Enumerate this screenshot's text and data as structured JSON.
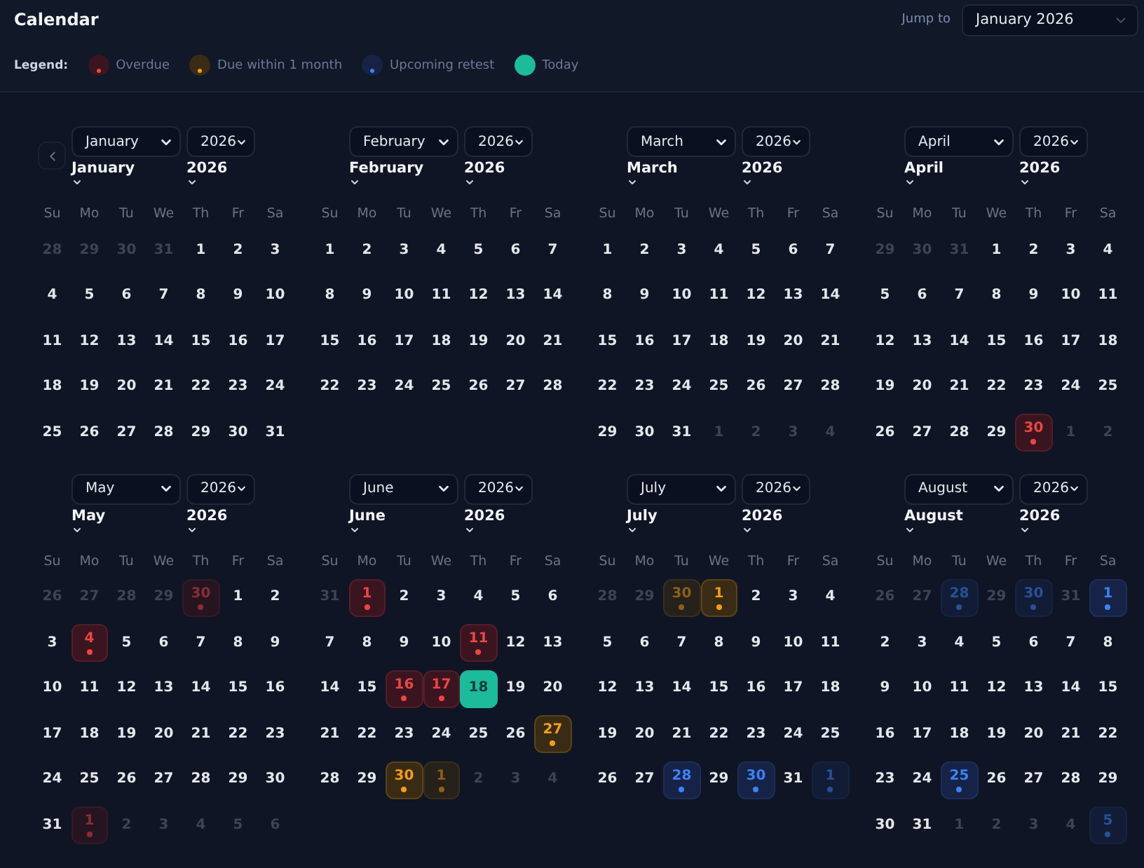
{
  "title": "Calendar",
  "jump": {
    "label": "Jump to",
    "value": "January 2026"
  },
  "legend": {
    "label": "Legend:",
    "items": [
      {
        "label": "Overdue",
        "kind": "overdue"
      },
      {
        "label": "Due within 1 month",
        "kind": "due"
      },
      {
        "label": "Upcoming retest",
        "kind": "retest"
      },
      {
        "label": "Today",
        "kind": "today"
      }
    ]
  },
  "months": [
    {
      "month": "January",
      "year": "2026",
      "caption_month": "January",
      "caption_year": "2026",
      "weekdays": [
        "Su",
        "Mo",
        "Tu",
        "We",
        "Th",
        "Fr",
        "Sa"
      ],
      "weeks": [
        [
          {
            "day": "28",
            "outside": true,
            "kind": "plain"
          },
          {
            "day": "29",
            "outside": true,
            "kind": "plain"
          },
          {
            "day": "30",
            "outside": true,
            "kind": "plain"
          },
          {
            "day": "31",
            "outside": true,
            "kind": "plain"
          },
          {
            "day": "1",
            "outside": false,
            "kind": "plain"
          },
          {
            "day": "2",
            "outside": false,
            "kind": "plain"
          },
          {
            "day": "3",
            "outside": false,
            "kind": "plain"
          }
        ],
        [
          {
            "day": "4",
            "outside": false,
            "kind": "plain"
          },
          {
            "day": "5",
            "outside": false,
            "kind": "plain"
          },
          {
            "day": "6",
            "outside": false,
            "kind": "plain"
          },
          {
            "day": "7",
            "outside": false,
            "kind": "plain"
          },
          {
            "day": "8",
            "outside": false,
            "kind": "plain"
          },
          {
            "day": "9",
            "outside": false,
            "kind": "plain"
          },
          {
            "day": "10",
            "outside": false,
            "kind": "plain"
          }
        ],
        [
          {
            "day": "11",
            "outside": false,
            "kind": "plain"
          },
          {
            "day": "12",
            "outside": false,
            "kind": "plain"
          },
          {
            "day": "13",
            "outside": false,
            "kind": "plain"
          },
          {
            "day": "14",
            "outside": false,
            "kind": "plain"
          },
          {
            "day": "15",
            "outside": false,
            "kind": "plain"
          },
          {
            "day": "16",
            "outside": false,
            "kind": "plain"
          },
          {
            "day": "17",
            "outside": false,
            "kind": "plain"
          }
        ],
        [
          {
            "day": "18",
            "outside": false,
            "kind": "plain"
          },
          {
            "day": "19",
            "outside": false,
            "kind": "plain"
          },
          {
            "day": "20",
            "outside": false,
            "kind": "plain"
          },
          {
            "day": "21",
            "outside": false,
            "kind": "plain"
          },
          {
            "day": "22",
            "outside": false,
            "kind": "plain"
          },
          {
            "day": "23",
            "outside": false,
            "kind": "plain"
          },
          {
            "day": "24",
            "outside": false,
            "kind": "plain"
          }
        ],
        [
          {
            "day": "25",
            "outside": false,
            "kind": "plain"
          },
          {
            "day": "26",
            "outside": false,
            "kind": "plain"
          },
          {
            "day": "27",
            "outside": false,
            "kind": "plain"
          },
          {
            "day": "28",
            "outside": false,
            "kind": "plain"
          },
          {
            "day": "29",
            "outside": false,
            "kind": "plain"
          },
          {
            "day": "30",
            "outside": false,
            "kind": "plain"
          },
          {
            "day": "31",
            "outside": false,
            "kind": "plain"
          }
        ]
      ]
    },
    {
      "month": "February",
      "year": "2026",
      "caption_month": "February",
      "caption_year": "2026",
      "weekdays": [
        "Su",
        "Mo",
        "Tu",
        "We",
        "Th",
        "Fr",
        "Sa"
      ],
      "weeks": [
        [
          {
            "day": "1",
            "outside": false,
            "kind": "plain"
          },
          {
            "day": "2",
            "outside": false,
            "kind": "plain"
          },
          {
            "day": "3",
            "outside": false,
            "kind": "plain"
          },
          {
            "day": "4",
            "outside": false,
            "kind": "plain"
          },
          {
            "day": "5",
            "outside": false,
            "kind": "plain"
          },
          {
            "day": "6",
            "outside": false,
            "kind": "plain"
          },
          {
            "day": "7",
            "outside": false,
            "kind": "plain"
          }
        ],
        [
          {
            "day": "8",
            "outside": false,
            "kind": "plain"
          },
          {
            "day": "9",
            "outside": false,
            "kind": "plain"
          },
          {
            "day": "10",
            "outside": false,
            "kind": "plain"
          },
          {
            "day": "11",
            "outside": false,
            "kind": "plain"
          },
          {
            "day": "12",
            "outside": false,
            "kind": "plain"
          },
          {
            "day": "13",
            "outside": false,
            "kind": "plain"
          },
          {
            "day": "14",
            "outside": false,
            "kind": "plain"
          }
        ],
        [
          {
            "day": "15",
            "outside": false,
            "kind": "plain"
          },
          {
            "day": "16",
            "outside": false,
            "kind": "plain"
          },
          {
            "day": "17",
            "outside": false,
            "kind": "plain"
          },
          {
            "day": "18",
            "outside": false,
            "kind": "plain"
          },
          {
            "day": "19",
            "outside": false,
            "kind": "plain"
          },
          {
            "day": "20",
            "outside": false,
            "kind": "plain"
          },
          {
            "day": "21",
            "outside": false,
            "kind": "plain"
          }
        ],
        [
          {
            "day": "22",
            "outside": false,
            "kind": "plain"
          },
          {
            "day": "23",
            "outside": false,
            "kind": "plain"
          },
          {
            "day": "24",
            "outside": false,
            "kind": "plain"
          },
          {
            "day": "25",
            "outside": false,
            "kind": "plain"
          },
          {
            "day": "26",
            "outside": false,
            "kind": "plain"
          },
          {
            "day": "27",
            "outside": false,
            "kind": "plain"
          },
          {
            "day": "28",
            "outside": false,
            "kind": "plain"
          }
        ]
      ]
    },
    {
      "month": "March",
      "year": "2026",
      "caption_month": "March",
      "caption_year": "2026",
      "weekdays": [
        "Su",
        "Mo",
        "Tu",
        "We",
        "Th",
        "Fr",
        "Sa"
      ],
      "weeks": [
        [
          {
            "day": "1",
            "outside": false,
            "kind": "plain"
          },
          {
            "day": "2",
            "outside": false,
            "kind": "plain"
          },
          {
            "day": "3",
            "outside": false,
            "kind": "plain"
          },
          {
            "day": "4",
            "outside": false,
            "kind": "plain"
          },
          {
            "day": "5",
            "outside": false,
            "kind": "plain"
          },
          {
            "day": "6",
            "outside": false,
            "kind": "plain"
          },
          {
            "day": "7",
            "outside": false,
            "kind": "plain"
          }
        ],
        [
          {
            "day": "8",
            "outside": false,
            "kind": "plain"
          },
          {
            "day": "9",
            "outside": false,
            "kind": "plain"
          },
          {
            "day": "10",
            "outside": false,
            "kind": "plain"
          },
          {
            "day": "11",
            "outside": false,
            "kind": "plain"
          },
          {
            "day": "12",
            "outside": false,
            "kind": "plain"
          },
          {
            "day": "13",
            "outside": false,
            "kind": "plain"
          },
          {
            "day": "14",
            "outside": false,
            "kind": "plain"
          }
        ],
        [
          {
            "day": "15",
            "outside": false,
            "kind": "plain"
          },
          {
            "day": "16",
            "outside": false,
            "kind": "plain"
          },
          {
            "day": "17",
            "outside": false,
            "kind": "plain"
          },
          {
            "day": "18",
            "outside": false,
            "kind": "plain"
          },
          {
            "day": "19",
            "outside": false,
            "kind": "plain"
          },
          {
            "day": "20",
            "outside": false,
            "kind": "plain"
          },
          {
            "day": "21",
            "outside": false,
            "kind": "plain"
          }
        ],
        [
          {
            "day": "22",
            "outside": false,
            "kind": "plain"
          },
          {
            "day": "23",
            "outside": false,
            "kind": "plain"
          },
          {
            "day": "24",
            "outside": false,
            "kind": "plain"
          },
          {
            "day": "25",
            "outside": false,
            "kind": "plain"
          },
          {
            "day": "26",
            "outside": false,
            "kind": "plain"
          },
          {
            "day": "27",
            "outside": false,
            "kind": "plain"
          },
          {
            "day": "28",
            "outside": false,
            "kind": "plain"
          }
        ],
        [
          {
            "day": "29",
            "outside": false,
            "kind": "plain"
          },
          {
            "day": "30",
            "outside": false,
            "kind": "plain"
          },
          {
            "day": "31",
            "outside": false,
            "kind": "plain"
          },
          {
            "day": "1",
            "outside": true,
            "kind": "plain"
          },
          {
            "day": "2",
            "outside": true,
            "kind": "plain"
          },
          {
            "day": "3",
            "outside": true,
            "kind": "plain"
          },
          {
            "day": "4",
            "outside": true,
            "kind": "plain"
          }
        ]
      ]
    },
    {
      "month": "April",
      "year": "2026",
      "caption_month": "April",
      "caption_year": "2026",
      "weekdays": [
        "Su",
        "Mo",
        "Tu",
        "We",
        "Th",
        "Fr",
        "Sa"
      ],
      "weeks": [
        [
          {
            "day": "29",
            "outside": true,
            "kind": "plain"
          },
          {
            "day": "30",
            "outside": true,
            "kind": "plain"
          },
          {
            "day": "31",
            "outside": true,
            "kind": "plain"
          },
          {
            "day": "1",
            "outside": false,
            "kind": "plain"
          },
          {
            "day": "2",
            "outside": false,
            "kind": "plain"
          },
          {
            "day": "3",
            "outside": false,
            "kind": "plain"
          },
          {
            "day": "4",
            "outside": false,
            "kind": "plain"
          }
        ],
        [
          {
            "day": "5",
            "outside": false,
            "kind": "plain"
          },
          {
            "day": "6",
            "outside": false,
            "kind": "plain"
          },
          {
            "day": "7",
            "outside": false,
            "kind": "plain"
          },
          {
            "day": "8",
            "outside": false,
            "kind": "plain"
          },
          {
            "day": "9",
            "outside": false,
            "kind": "plain"
          },
          {
            "day": "10",
            "outside": false,
            "kind": "plain"
          },
          {
            "day": "11",
            "outside": false,
            "kind": "plain"
          }
        ],
        [
          {
            "day": "12",
            "outside": false,
            "kind": "plain"
          },
          {
            "day": "13",
            "outside": false,
            "kind": "plain"
          },
          {
            "day": "14",
            "outside": false,
            "kind": "plain"
          },
          {
            "day": "15",
            "outside": false,
            "kind": "plain"
          },
          {
            "day": "16",
            "outside": false,
            "kind": "plain"
          },
          {
            "day": "17",
            "outside": false,
            "kind": "plain"
          },
          {
            "day": "18",
            "outside": false,
            "kind": "plain"
          }
        ],
        [
          {
            "day": "19",
            "outside": false,
            "kind": "plain"
          },
          {
            "day": "20",
            "outside": false,
            "kind": "plain"
          },
          {
            "day": "21",
            "outside": false,
            "kind": "plain"
          },
          {
            "day": "22",
            "outside": false,
            "kind": "plain"
          },
          {
            "day": "23",
            "outside": false,
            "kind": "plain"
          },
          {
            "day": "24",
            "outside": false,
            "kind": "plain"
          },
          {
            "day": "25",
            "outside": false,
            "kind": "plain"
          }
        ],
        [
          {
            "day": "26",
            "outside": false,
            "kind": "plain"
          },
          {
            "day": "27",
            "outside": false,
            "kind": "plain"
          },
          {
            "day": "28",
            "outside": false,
            "kind": "plain"
          },
          {
            "day": "29",
            "outside": false,
            "kind": "plain"
          },
          {
            "day": "30",
            "outside": false,
            "kind": "overdue"
          },
          {
            "day": "1",
            "outside": true,
            "kind": "plain"
          },
          {
            "day": "2",
            "outside": true,
            "kind": "plain"
          }
        ]
      ]
    },
    {
      "month": "May",
      "year": "2026",
      "caption_month": "May",
      "caption_year": "2026",
      "weekdays": [
        "Su",
        "Mo",
        "Tu",
        "We",
        "Th",
        "Fr",
        "Sa"
      ],
      "weeks": [
        [
          {
            "day": "26",
            "outside": true,
            "kind": "plain"
          },
          {
            "day": "27",
            "outside": true,
            "kind": "plain"
          },
          {
            "day": "28",
            "outside": true,
            "kind": "plain"
          },
          {
            "day": "29",
            "outside": true,
            "kind": "plain"
          },
          {
            "day": "30",
            "outside": true,
            "kind": "overdue"
          },
          {
            "day": "1",
            "outside": false,
            "kind": "plain"
          },
          {
            "day": "2",
            "outside": false,
            "kind": "plain"
          }
        ],
        [
          {
            "day": "3",
            "outside": false,
            "kind": "plain"
          },
          {
            "day": "4",
            "outside": false,
            "kind": "overdue"
          },
          {
            "day": "5",
            "outside": false,
            "kind": "plain"
          },
          {
            "day": "6",
            "outside": false,
            "kind": "plain"
          },
          {
            "day": "7",
            "outside": false,
            "kind": "plain"
          },
          {
            "day": "8",
            "outside": false,
            "kind": "plain"
          },
          {
            "day": "9",
            "outside": false,
            "kind": "plain"
          }
        ],
        [
          {
            "day": "10",
            "outside": false,
            "kind": "plain"
          },
          {
            "day": "11",
            "outside": false,
            "kind": "plain"
          },
          {
            "day": "12",
            "outside": false,
            "kind": "plain"
          },
          {
            "day": "13",
            "outside": false,
            "kind": "plain"
          },
          {
            "day": "14",
            "outside": false,
            "kind": "plain"
          },
          {
            "day": "15",
            "outside": false,
            "kind": "plain"
          },
          {
            "day": "16",
            "outside": false,
            "kind": "plain"
          }
        ],
        [
          {
            "day": "17",
            "outside": false,
            "kind": "plain"
          },
          {
            "day": "18",
            "outside": false,
            "kind": "plain"
          },
          {
            "day": "19",
            "outside": false,
            "kind": "plain"
          },
          {
            "day": "20",
            "outside": false,
            "kind": "plain"
          },
          {
            "day": "21",
            "outside": false,
            "kind": "plain"
          },
          {
            "day": "22",
            "outside": false,
            "kind": "plain"
          },
          {
            "day": "23",
            "outside": false,
            "kind": "plain"
          }
        ],
        [
          {
            "day": "24",
            "outside": false,
            "kind": "plain"
          },
          {
            "day": "25",
            "outside": false,
            "kind": "plain"
          },
          {
            "day": "26",
            "outside": false,
            "kind": "plain"
          },
          {
            "day": "27",
            "outside": false,
            "kind": "plain"
          },
          {
            "day": "28",
            "outside": false,
            "kind": "plain"
          },
          {
            "day": "29",
            "outside": false,
            "kind": "plain"
          },
          {
            "day": "30",
            "outside": false,
            "kind": "plain"
          }
        ],
        [
          {
            "day": "31",
            "outside": false,
            "kind": "plain"
          },
          {
            "day": "1",
            "outside": true,
            "kind": "overdue"
          },
          {
            "day": "2",
            "outside": true,
            "kind": "plain"
          },
          {
            "day": "3",
            "outside": true,
            "kind": "plain"
          },
          {
            "day": "4",
            "outside": true,
            "kind": "plain"
          },
          {
            "day": "5",
            "outside": true,
            "kind": "plain"
          },
          {
            "day": "6",
            "outside": true,
            "kind": "plain"
          }
        ]
      ]
    },
    {
      "month": "June",
      "year": "2026",
      "caption_month": "June",
      "caption_year": "2026",
      "weekdays": [
        "Su",
        "Mo",
        "Tu",
        "We",
        "Th",
        "Fr",
        "Sa"
      ],
      "weeks": [
        [
          {
            "day": "31",
            "outside": true,
            "kind": "plain"
          },
          {
            "day": "1",
            "outside": false,
            "kind": "overdue"
          },
          {
            "day": "2",
            "outside": false,
            "kind": "plain"
          },
          {
            "day": "3",
            "outside": false,
            "kind": "plain"
          },
          {
            "day": "4",
            "outside": false,
            "kind": "plain"
          },
          {
            "day": "5",
            "outside": false,
            "kind": "plain"
          },
          {
            "day": "6",
            "outside": false,
            "kind": "plain"
          }
        ],
        [
          {
            "day": "7",
            "outside": false,
            "kind": "plain"
          },
          {
            "day": "8",
            "outside": false,
            "kind": "plain"
          },
          {
            "day": "9",
            "outside": false,
            "kind": "plain"
          },
          {
            "day": "10",
            "outside": false,
            "kind": "plain"
          },
          {
            "day": "11",
            "outside": false,
            "kind": "overdue"
          },
          {
            "day": "12",
            "outside": false,
            "kind": "plain"
          },
          {
            "day": "13",
            "outside": false,
            "kind": "plain"
          }
        ],
        [
          {
            "day": "14",
            "outside": false,
            "kind": "plain"
          },
          {
            "day": "15",
            "outside": false,
            "kind": "plain"
          },
          {
            "day": "16",
            "outside": false,
            "kind": "overdue"
          },
          {
            "day": "17",
            "outside": false,
            "kind": "overdue"
          },
          {
            "day": "18",
            "outside": false,
            "kind": "today"
          },
          {
            "day": "19",
            "outside": false,
            "kind": "plain"
          },
          {
            "day": "20",
            "outside": false,
            "kind": "plain"
          }
        ],
        [
          {
            "day": "21",
            "outside": false,
            "kind": "plain"
          },
          {
            "day": "22",
            "outside": false,
            "kind": "plain"
          },
          {
            "day": "23",
            "outside": false,
            "kind": "plain"
          },
          {
            "day": "24",
            "outside": false,
            "kind": "plain"
          },
          {
            "day": "25",
            "outside": false,
            "kind": "plain"
          },
          {
            "day": "26",
            "outside": false,
            "kind": "plain"
          },
          {
            "day": "27",
            "outside": false,
            "kind": "due"
          }
        ],
        [
          {
            "day": "28",
            "outside": false,
            "kind": "plain"
          },
          {
            "day": "29",
            "outside": false,
            "kind": "plain"
          },
          {
            "day": "30",
            "outside": false,
            "kind": "due"
          },
          {
            "day": "1",
            "outside": true,
            "kind": "due"
          },
          {
            "day": "2",
            "outside": true,
            "kind": "plain"
          },
          {
            "day": "3",
            "outside": true,
            "kind": "plain"
          },
          {
            "day": "4",
            "outside": true,
            "kind": "plain"
          }
        ]
      ]
    },
    {
      "month": "July",
      "year": "2026",
      "caption_month": "July",
      "caption_year": "2026",
      "weekdays": [
        "Su",
        "Mo",
        "Tu",
        "We",
        "Th",
        "Fr",
        "Sa"
      ],
      "weeks": [
        [
          {
            "day": "28",
            "outside": true,
            "kind": "plain"
          },
          {
            "day": "29",
            "outside": true,
            "kind": "plain"
          },
          {
            "day": "30",
            "outside": true,
            "kind": "due"
          },
          {
            "day": "1",
            "outside": false,
            "kind": "due"
          },
          {
            "day": "2",
            "outside": false,
            "kind": "plain"
          },
          {
            "day": "3",
            "outside": false,
            "kind": "plain"
          },
          {
            "day": "4",
            "outside": false,
            "kind": "plain"
          }
        ],
        [
          {
            "day": "5",
            "outside": false,
            "kind": "plain"
          },
          {
            "day": "6",
            "outside": false,
            "kind": "plain"
          },
          {
            "day": "7",
            "outside": false,
            "kind": "plain"
          },
          {
            "day": "8",
            "outside": false,
            "kind": "plain"
          },
          {
            "day": "9",
            "outside": false,
            "kind": "plain"
          },
          {
            "day": "10",
            "outside": false,
            "kind": "plain"
          },
          {
            "day": "11",
            "outside": false,
            "kind": "plain"
          }
        ],
        [
          {
            "day": "12",
            "outside": false,
            "kind": "plain"
          },
          {
            "day": "13",
            "outside": false,
            "kind": "plain"
          },
          {
            "day": "14",
            "outside": false,
            "kind": "plain"
          },
          {
            "day": "15",
            "outside": false,
            "kind": "plain"
          },
          {
            "day": "16",
            "outside": false,
            "kind": "plain"
          },
          {
            "day": "17",
            "outside": false,
            "kind": "plain"
          },
          {
            "day": "18",
            "outside": false,
            "kind": "plain"
          }
        ],
        [
          {
            "day": "19",
            "outside": false,
            "kind": "plain"
          },
          {
            "day": "20",
            "outside": false,
            "kind": "plain"
          },
          {
            "day": "21",
            "outside": false,
            "kind": "plain"
          },
          {
            "day": "22",
            "outside": false,
            "kind": "plain"
          },
          {
            "day": "23",
            "outside": false,
            "kind": "plain"
          },
          {
            "day": "24",
            "outside": false,
            "kind": "plain"
          },
          {
            "day": "25",
            "outside": false,
            "kind": "plain"
          }
        ],
        [
          {
            "day": "26",
            "outside": false,
            "kind": "plain"
          },
          {
            "day": "27",
            "outside": false,
            "kind": "plain"
          },
          {
            "day": "28",
            "outside": false,
            "kind": "retest"
          },
          {
            "day": "29",
            "outside": false,
            "kind": "plain"
          },
          {
            "day": "30",
            "outside": false,
            "kind": "retest"
          },
          {
            "day": "31",
            "outside": false,
            "kind": "plain"
          },
          {
            "day": "1",
            "outside": true,
            "kind": "retest"
          }
        ]
      ]
    },
    {
      "month": "August",
      "year": "2026",
      "caption_month": "August",
      "caption_year": "2026",
      "weekdays": [
        "Su",
        "Mo",
        "Tu",
        "We",
        "Th",
        "Fr",
        "Sa"
      ],
      "weeks": [
        [
          {
            "day": "26",
            "outside": true,
            "kind": "plain"
          },
          {
            "day": "27",
            "outside": true,
            "kind": "plain"
          },
          {
            "day": "28",
            "outside": true,
            "kind": "retest"
          },
          {
            "day": "29",
            "outside": true,
            "kind": "plain"
          },
          {
            "day": "30",
            "outside": true,
            "kind": "retest"
          },
          {
            "day": "31",
            "outside": true,
            "kind": "plain"
          },
          {
            "day": "1",
            "outside": false,
            "kind": "retest"
          }
        ],
        [
          {
            "day": "2",
            "outside": false,
            "kind": "plain"
          },
          {
            "day": "3",
            "outside": false,
            "kind": "plain"
          },
          {
            "day": "4",
            "outside": false,
            "kind": "plain"
          },
          {
            "day": "5",
            "outside": false,
            "kind": "plain"
          },
          {
            "day": "6",
            "outside": false,
            "kind": "plain"
          },
          {
            "day": "7",
            "outside": false,
            "kind": "plain"
          },
          {
            "day": "8",
            "outside": false,
            "kind": "plain"
          }
        ],
        [
          {
            "day": "9",
            "outside": false,
            "kind": "plain"
          },
          {
            "day": "10",
            "outside": false,
            "kind": "plain"
          },
          {
            "day": "11",
            "outside": false,
            "kind": "plain"
          },
          {
            "day": "12",
            "outside": false,
            "kind": "plain"
          },
          {
            "day": "13",
            "outside": false,
            "kind": "plain"
          },
          {
            "day": "14",
            "outside": false,
            "kind": "plain"
          },
          {
            "day": "15",
            "outside": false,
            "kind": "plain"
          }
        ],
        [
          {
            "day": "16",
            "outside": false,
            "kind": "plain"
          },
          {
            "day": "17",
            "outside": false,
            "kind": "plain"
          },
          {
            "day": "18",
            "outside": false,
            "kind": "plain"
          },
          {
            "day": "19",
            "outside": false,
            "kind": "plain"
          },
          {
            "day": "20",
            "outside": false,
            "kind": "plain"
          },
          {
            "day": "21",
            "outside": false,
            "kind": "plain"
          },
          {
            "day": "22",
            "outside": false,
            "kind": "plain"
          }
        ],
        [
          {
            "day": "23",
            "outside": false,
            "kind": "plain"
          },
          {
            "day": "24",
            "outside": false,
            "kind": "plain"
          },
          {
            "day": "25",
            "outside": false,
            "kind": "retest"
          },
          {
            "day": "26",
            "outside": false,
            "kind": "plain"
          },
          {
            "day": "27",
            "outside": false,
            "kind": "plain"
          },
          {
            "day": "28",
            "outside": false,
            "kind": "plain"
          },
          {
            "day": "29",
            "outside": false,
            "kind": "plain"
          }
        ],
        [
          {
            "day": "30",
            "outside": false,
            "kind": "plain"
          },
          {
            "day": "31",
            "outside": false,
            "kind": "plain"
          },
          {
            "day": "1",
            "outside": true,
            "kind": "plain"
          },
          {
            "day": "2",
            "outside": true,
            "kind": "plain"
          },
          {
            "day": "3",
            "outside": true,
            "kind": "plain"
          },
          {
            "day": "4",
            "outside": true,
            "kind": "plain"
          },
          {
            "day": "5",
            "outside": true,
            "kind": "retest"
          }
        ]
      ]
    }
  ]
}
